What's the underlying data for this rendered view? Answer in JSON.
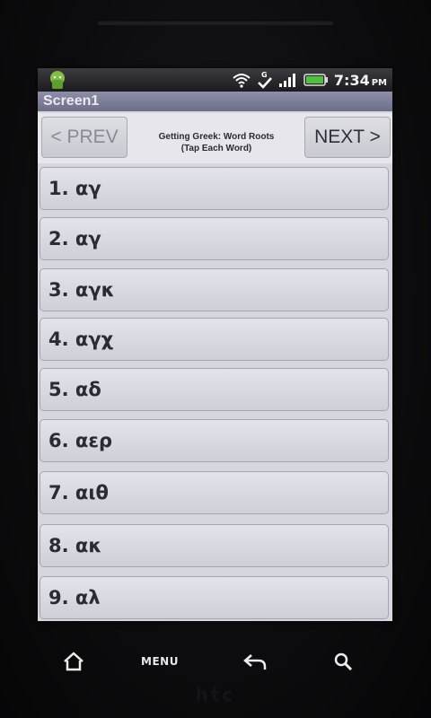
{
  "status_bar": {
    "time": "7:34",
    "time_suffix": "PM",
    "icons": [
      "android-app-icon",
      "wifi-icon",
      "sync-check-icon",
      "signal-icon",
      "battery-icon"
    ]
  },
  "title_bar": {
    "title": "Screen1"
  },
  "nav": {
    "prev_label": "< PREV",
    "next_label": "NEXT >",
    "title_line1": "Getting Greek: Word Roots",
    "title_line2": "(Tap Each Word)"
  },
  "list": {
    "items": [
      {
        "label": "1. αγ"
      },
      {
        "label": "2. αγ"
      },
      {
        "label": "3. αγκ"
      },
      {
        "label": "4. αγχ"
      },
      {
        "label": "5. αδ"
      },
      {
        "label": "6. αερ"
      },
      {
        "label": "7. αιθ"
      },
      {
        "label": "8. ακ"
      },
      {
        "label": "9. αλ"
      }
    ]
  },
  "hardware_keys": {
    "home_icon": "home-icon",
    "menu_label": "MENU",
    "back_icon": "back-arrow-icon",
    "search_icon": "search-icon"
  },
  "device": {
    "brand": "htc"
  }
}
